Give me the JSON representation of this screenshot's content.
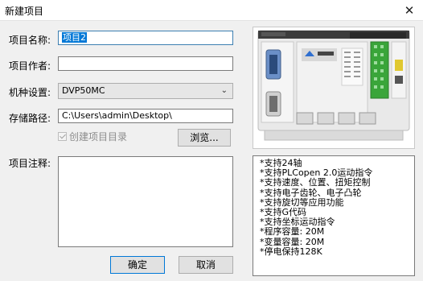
{
  "window": {
    "title": "新建项目",
    "close_symbol": "✕"
  },
  "form": {
    "name_label": "项目名称:",
    "name_value": "项目2",
    "author_label": "项目作者:",
    "author_value": "",
    "model_label": "机种设置:",
    "model_value": "DVP50MC",
    "path_label": "存储路径:",
    "path_value": "C:\\Users\\admin\\Desktop\\",
    "create_dir_label": "创建项目目录",
    "create_dir_checked": true,
    "browse_label": "浏览...",
    "notes_label": "项目注释:",
    "notes_value": ""
  },
  "buttons": {
    "ok_label": "确定",
    "cancel_label": "取消"
  },
  "device": {
    "image_icon": "plc-controller-image",
    "features": [
      "*支持24轴",
      "*支持PLCopen 2.0运动指令",
      "*支持速度、位置、扭矩控制",
      "*支持电子齿轮、电子凸轮",
      "*支持旋切等应用功能",
      "*支持G代码",
      "*支持坐标运动指令",
      "*程序容量: 20M",
      "*变量容量: 20M",
      "*停电保持128K"
    ]
  },
  "colors": {
    "selection": "#0078d7",
    "accent_green": "#3aa53a",
    "accent_blue": "#2f6fd0"
  }
}
